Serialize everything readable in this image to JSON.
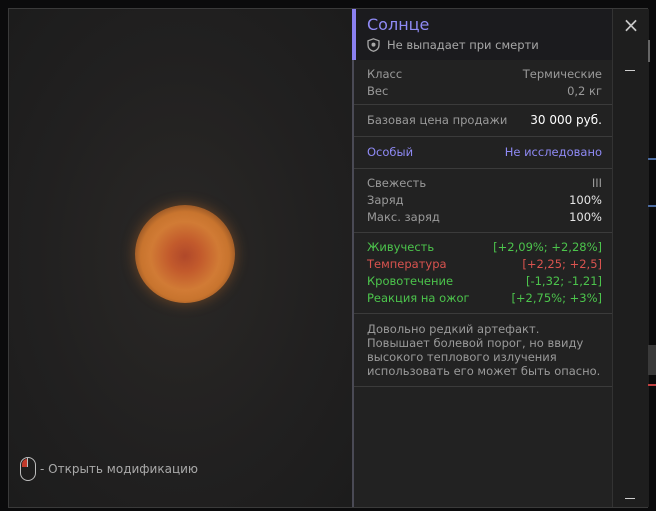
{
  "item": {
    "title": "Солнце",
    "subtitle": "Не выпадает при смерти",
    "colors": {
      "accent": "#8f8af5",
      "positive": "#4cc44c",
      "negative": "#d9534f"
    }
  },
  "basic": [
    {
      "label": "Класс",
      "value": "Термические"
    },
    {
      "label": "Вес",
      "value": "0,2 кг"
    }
  ],
  "price": {
    "label": "Базовая цена продажи",
    "value": "30 000 руб."
  },
  "special": {
    "label": "Особый",
    "value": "Не исследовано"
  },
  "condition": [
    {
      "label": "Свежесть",
      "value": "III"
    },
    {
      "label": "Заряд",
      "value": "100%"
    },
    {
      "label": "Макс. заряд",
      "value": "100%"
    }
  ],
  "effects": [
    {
      "label": "Живучесть",
      "value": "[+2,09%; +2,28%]",
      "tone": "positive"
    },
    {
      "label": "Температура",
      "value": "[+2,25; +2,5]",
      "tone": "negative"
    },
    {
      "label": "Кровотечение",
      "value": "[-1,32; -1,21]",
      "tone": "positive"
    },
    {
      "label": "Реакция на ожог",
      "value": "[+2,75%; +3%]",
      "tone": "positive"
    }
  ],
  "description": "Довольно редкий артефакт. Повышает болевой порог, но ввиду высокого теплового излучения использовать его может быть опасно.",
  "hint": {
    "text": "- Открыть модификацию",
    "icon": "mouse-icon"
  },
  "controls": {
    "close": "×"
  }
}
